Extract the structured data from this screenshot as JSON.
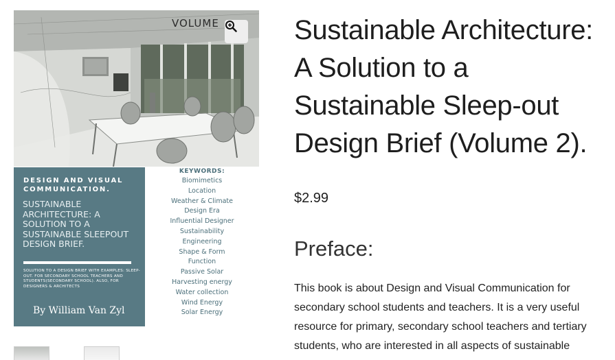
{
  "cover": {
    "volume_word": "VOLUME",
    "zoom_icon": "zoom-in-icon",
    "panel_heading": "DESIGN AND VISUAL COMMUNICATION.",
    "panel_subtitle": "SUSTAINABLE ARCHITECTURE: A SOLUTION TO A SUSTAINABLE SLEEPOUT DESIGN BRIEF.",
    "panel_small": "SOLUTION TO A DESIGN BRIEF WITH EXAMPLES: SLEEP-OUT. FOR SECONDARY SCHOOL TEACHERS AND STUDENTS(SECONDARY SCHOOL). ALSO, FOR DESIGNERS & ARCHITECTS",
    "author": "By William Van Zyl",
    "keywords_title": "KEYWORDS:",
    "keywords": [
      "Biomimetics",
      "Location",
      "Weather & Climate",
      "Design Era",
      "Influential Designer",
      "Sustainability",
      "Engineering",
      "Shape & Form",
      "Function",
      "Passive Solar",
      "Harvesting energy",
      "Water collection",
      "Wind Energy",
      "Solar Energy"
    ],
    "panel_color": "#587a84"
  },
  "product": {
    "title": "Sustainable Architecture: A Solution to a Sustainable Sleep-out Design Brief (Volume 2).",
    "price": "$2.99",
    "preface_heading": "Preface:",
    "description": "This book is about Design and Visual Communication for secondary school students and teachers. It is a very useful resource for primary, secondary school teachers and tertiary students, who are interested in all aspects of sustainable"
  }
}
